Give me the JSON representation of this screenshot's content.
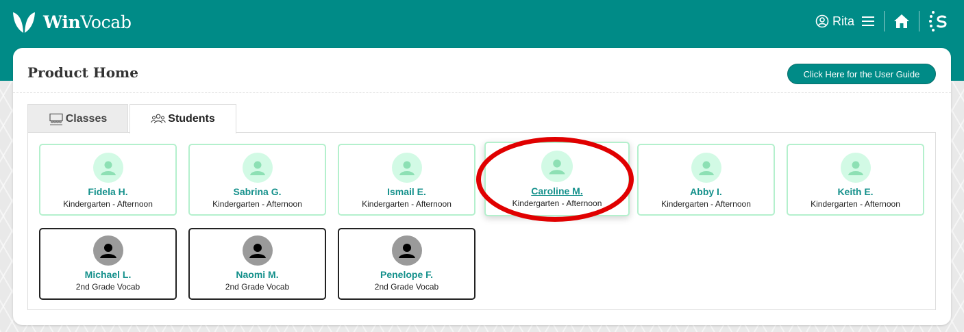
{
  "header": {
    "brand_bold": "Win",
    "brand_rest": "Vocab",
    "user_name": "Rita",
    "brand_color": "#008b87"
  },
  "page": {
    "title": "Product Home",
    "guide_button": "Click Here for the User Guide"
  },
  "tabs": [
    {
      "label": "Classes",
      "icon": "classroom-icon",
      "active": false
    },
    {
      "label": "Students",
      "icon": "users-icon",
      "active": true
    }
  ],
  "students": [
    {
      "name": "Fidela H.",
      "class": "Kindergarten - Afternoon",
      "style": "light"
    },
    {
      "name": "Sabrina G.",
      "class": "Kindergarten - Afternoon",
      "style": "light"
    },
    {
      "name": "Ismail E.",
      "class": "Kindergarten - Afternoon",
      "style": "light"
    },
    {
      "name": "Caroline M.",
      "class": "Kindergarten - Afternoon",
      "style": "light",
      "hovered": true
    },
    {
      "name": "Abby I.",
      "class": "Kindergarten - Afternoon",
      "style": "light"
    },
    {
      "name": "Keith E.",
      "class": "Kindergarten - Afternoon",
      "style": "light"
    },
    {
      "name": "Michael L.",
      "class": "2nd Grade Vocab",
      "style": "dark"
    },
    {
      "name": "Naomi M.",
      "class": "2nd Grade Vocab",
      "style": "dark"
    },
    {
      "name": "Penelope F.",
      "class": "2nd Grade Vocab",
      "style": "dark"
    }
  ],
  "colors": {
    "accent": "#008b87",
    "card_border_light": "#b4f0cd",
    "name_text": "#14908b",
    "highlight": "#e00000"
  }
}
